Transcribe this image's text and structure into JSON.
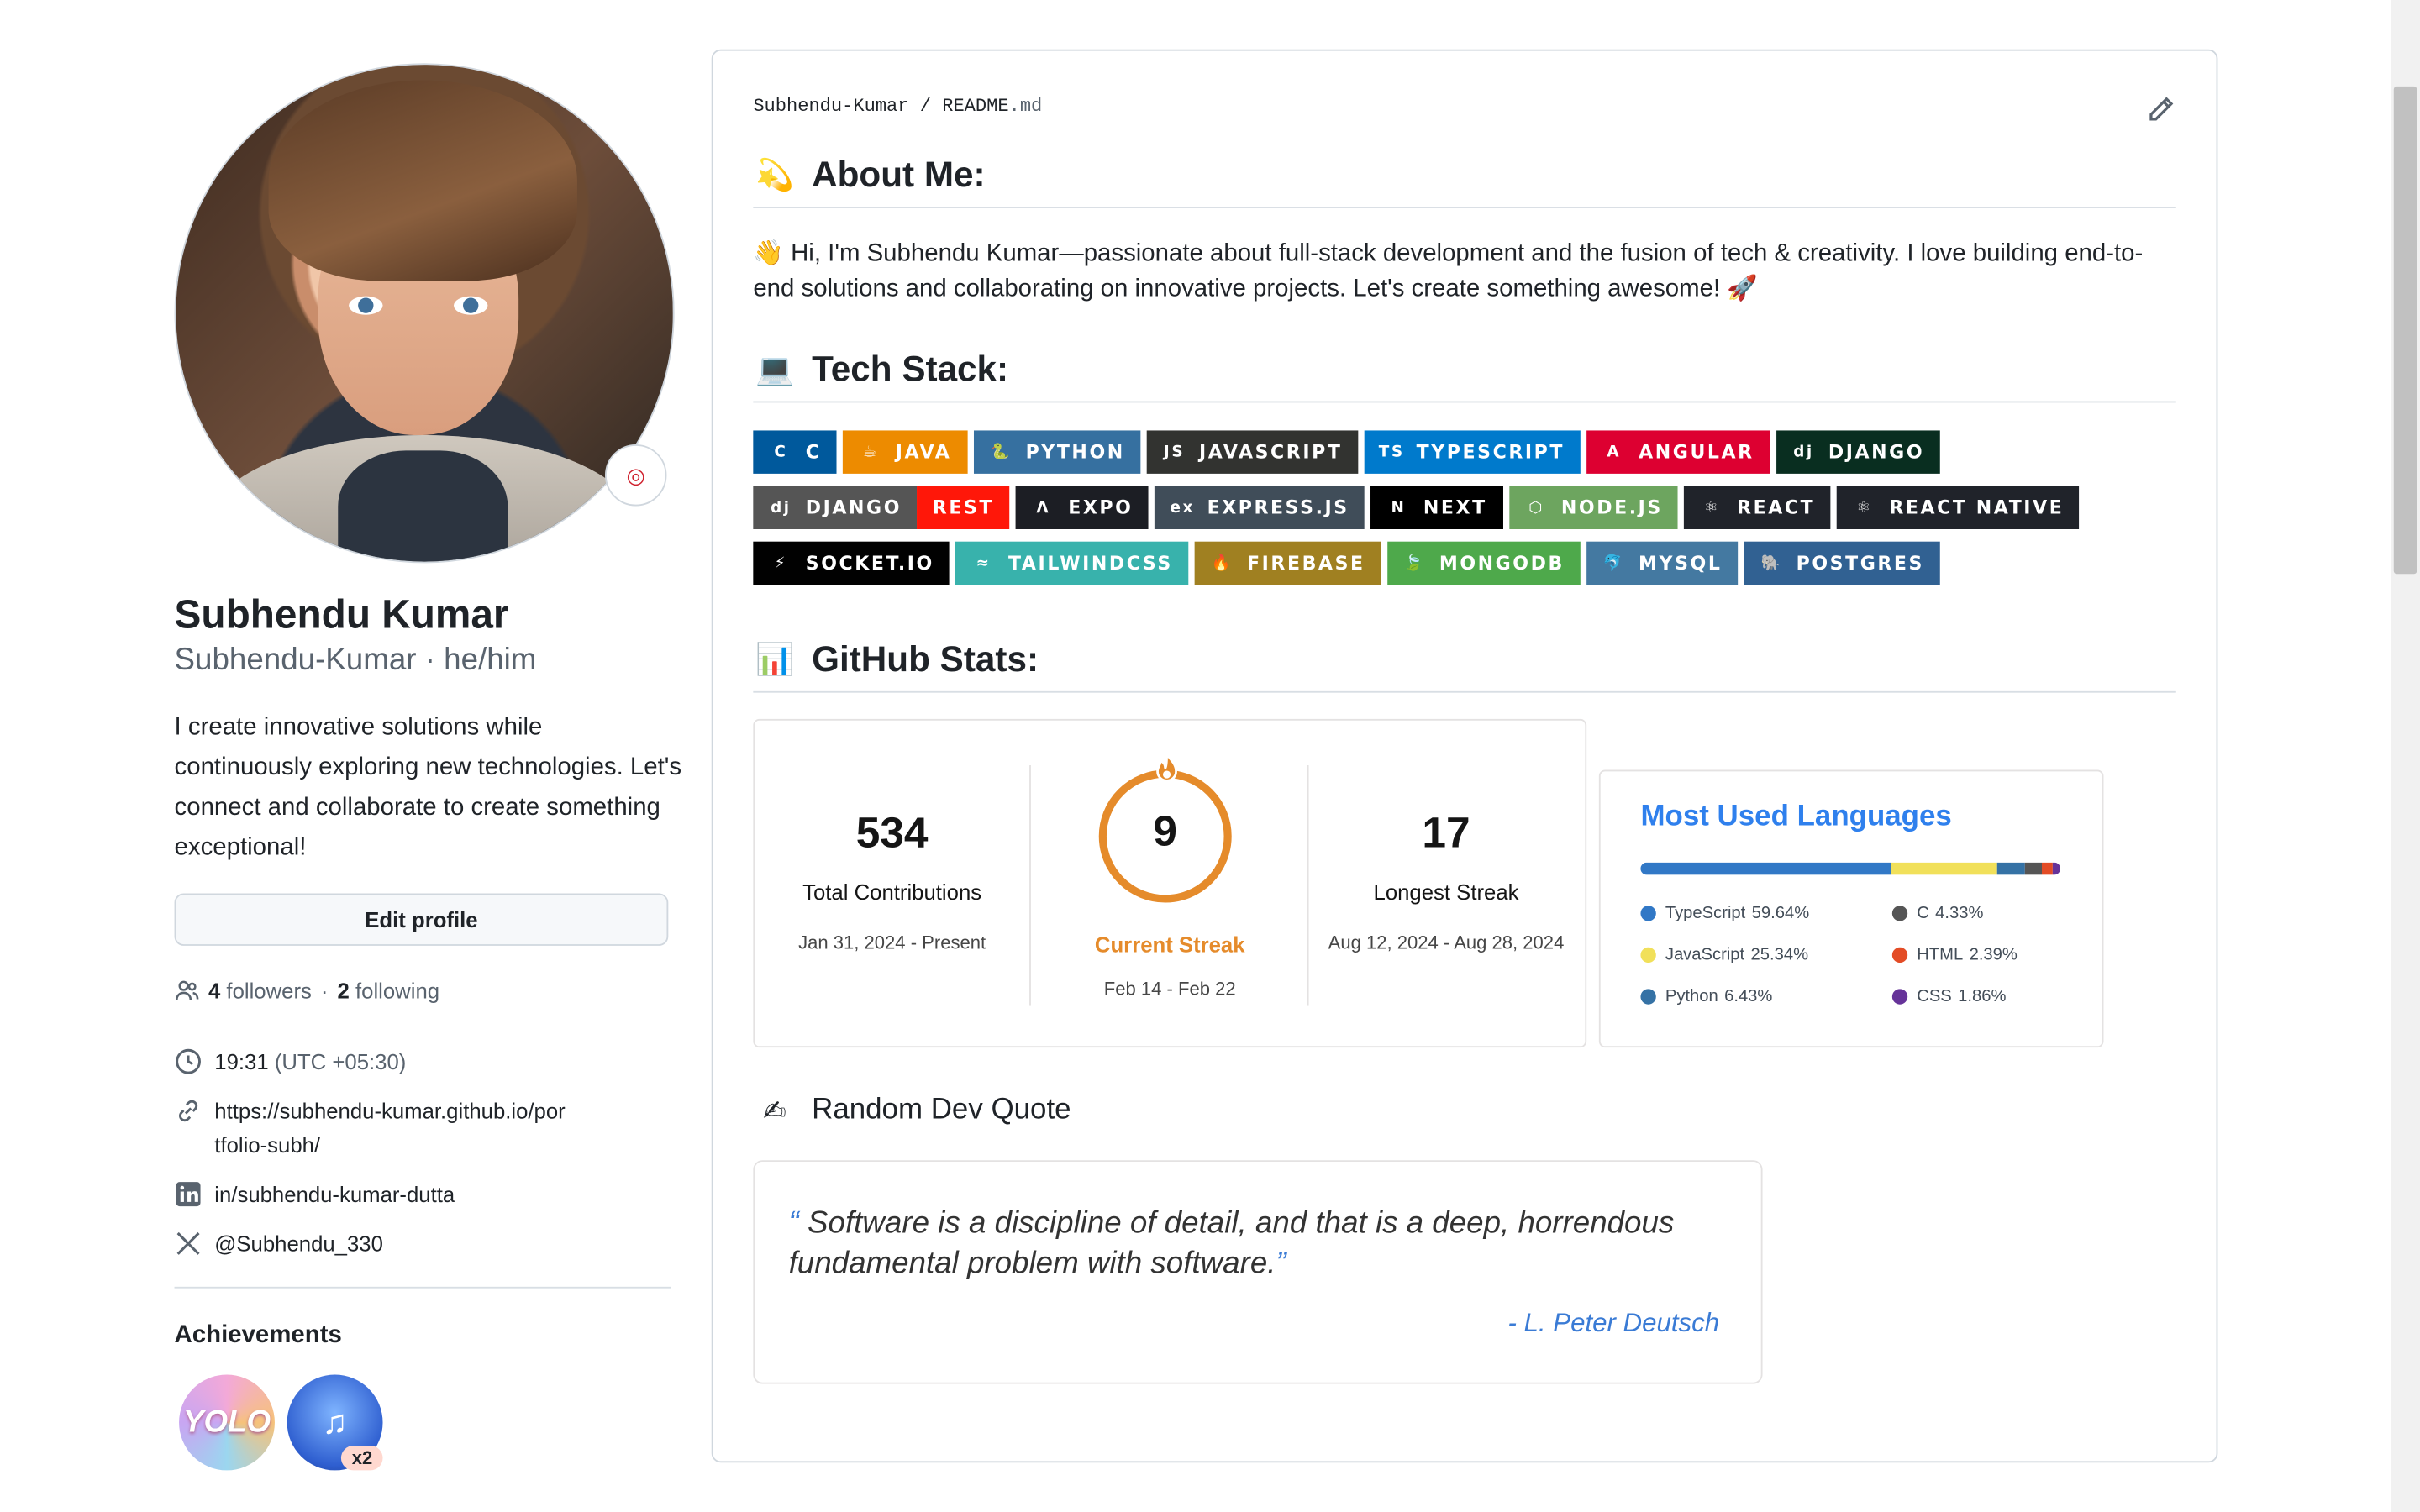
{
  "profile": {
    "name": "Subhendu Kumar",
    "login": "Subhendu-Kumar · he/him",
    "bio": "I create innovative solutions while continuously exploring new technologies. Let's connect and collaborate to create something exceptional!",
    "edit_label": "Edit profile",
    "followers_count": "4",
    "followers_label": "followers",
    "following_count": "2",
    "following_label": "following",
    "time": "19:31",
    "timezone": "(UTC +05:30)",
    "website": "https://subhendu-kumar.github.io/portfolio-subh/",
    "linkedin": "in/subhendu-kumar-dutta",
    "twitter": "@Subhendu_330",
    "achievements_title": "Achievements",
    "achievement_yolo": "YOLO",
    "achievement_count": "x2"
  },
  "readme": {
    "crumb_user": "Subhendu-Kumar",
    "crumb_sep": "/",
    "crumb_file": "README",
    "crumb_ext": ".md",
    "about_title": "About Me:",
    "about_text": "👋 Hi, I'm Subhendu Kumar—passionate about full-stack development and the fusion of tech & creativity. I love building end-to-end solutions and collaborating on innovative projects. Let's create something awesome! 🚀",
    "tech_title": "Tech Stack:",
    "stats_title": "GitHub Stats:",
    "quote_title": "Random Dev Quote"
  },
  "badges": [
    [
      {
        "label": "C",
        "bg": "#00599C",
        "icon": "C"
      },
      {
        "label": "JAVA",
        "bg": "#ED8B00",
        "icon": "☕"
      },
      {
        "label": "PYTHON",
        "bg": "#3670A0",
        "icon": "🐍"
      },
      {
        "label": "JAVASCRIPT",
        "bg": "#323330",
        "icon": "JS"
      },
      {
        "label": "TYPESCRIPT",
        "bg": "#007ACC",
        "icon": "TS"
      },
      {
        "label": "ANGULAR",
        "bg": "#DD0031",
        "icon": "A"
      },
      {
        "label": "DJANGO",
        "bg": "#092E20",
        "icon": "dj"
      }
    ],
    [
      {
        "label": "DJANGO",
        "bg": "#555555",
        "icon": "dj",
        "extra": "REST",
        "extra_bg": "#ff1709"
      },
      {
        "label": "EXPO",
        "bg": "#1C1E24",
        "icon": "Λ"
      },
      {
        "label": "EXPRESS.JS",
        "bg": "#404d59",
        "icon": "ex"
      },
      {
        "label": "NEXT",
        "bg": "#000000",
        "icon": "N"
      },
      {
        "label": "NODE.JS",
        "bg": "#6DA55F",
        "icon": "⬡"
      },
      {
        "label": "REACT",
        "bg": "#20232a",
        "icon": "⚛"
      },
      {
        "label": "REACT NATIVE",
        "bg": "#20232a",
        "icon": "⚛"
      }
    ],
    [
      {
        "label": "SOCKET.IO",
        "bg": "#010101",
        "icon": "⚡"
      },
      {
        "label": "TAILWINDCSS",
        "bg": "#38B2AC",
        "icon": "≈"
      },
      {
        "label": "FIREBASE",
        "bg": "#a08021",
        "icon": "🔥"
      },
      {
        "label": "MONGODB",
        "bg": "#4ea94b",
        "icon": "🍃"
      },
      {
        "label": "MYSQL",
        "bg": "#4479A1",
        "icon": "🐬"
      },
      {
        "label": "POSTGRES",
        "bg": "#316192",
        "icon": "🐘"
      }
    ]
  ],
  "streak": {
    "total": "534",
    "total_label": "Total Contributions",
    "total_range": "Jan 31, 2024 - Present",
    "current": "9",
    "current_label": "Current Streak",
    "current_range": "Feb 14 - Feb 22",
    "longest": "17",
    "longest_label": "Longest Streak",
    "longest_range": "Aug 12, 2024 - Aug 28, 2024",
    "accent": "#e58b2b"
  },
  "languages": {
    "title": "Most Used Languages",
    "items": [
      {
        "name": "TypeScript",
        "pct": 59.64,
        "pct_label": "59.64%",
        "color": "#3178c6"
      },
      {
        "name": "JavaScript",
        "pct": 25.34,
        "pct_label": "25.34%",
        "color": "#f1e05a"
      },
      {
        "name": "Python",
        "pct": 6.43,
        "pct_label": "6.43%",
        "color": "#3572A5"
      },
      {
        "name": "C",
        "pct": 4.33,
        "pct_label": "4.33%",
        "color": "#555555"
      },
      {
        "name": "HTML",
        "pct": 2.39,
        "pct_label": "2.39%",
        "color": "#e34c26"
      },
      {
        "name": "CSS",
        "pct": 1.86,
        "pct_label": "1.86%",
        "color": "#663399"
      }
    ]
  },
  "quote": {
    "open": "“",
    "text": "Software is a discipline of detail, and that is a deep, horrendous fundamental problem with software.",
    "close": "”",
    "author": "- L. Peter Deutsch"
  }
}
